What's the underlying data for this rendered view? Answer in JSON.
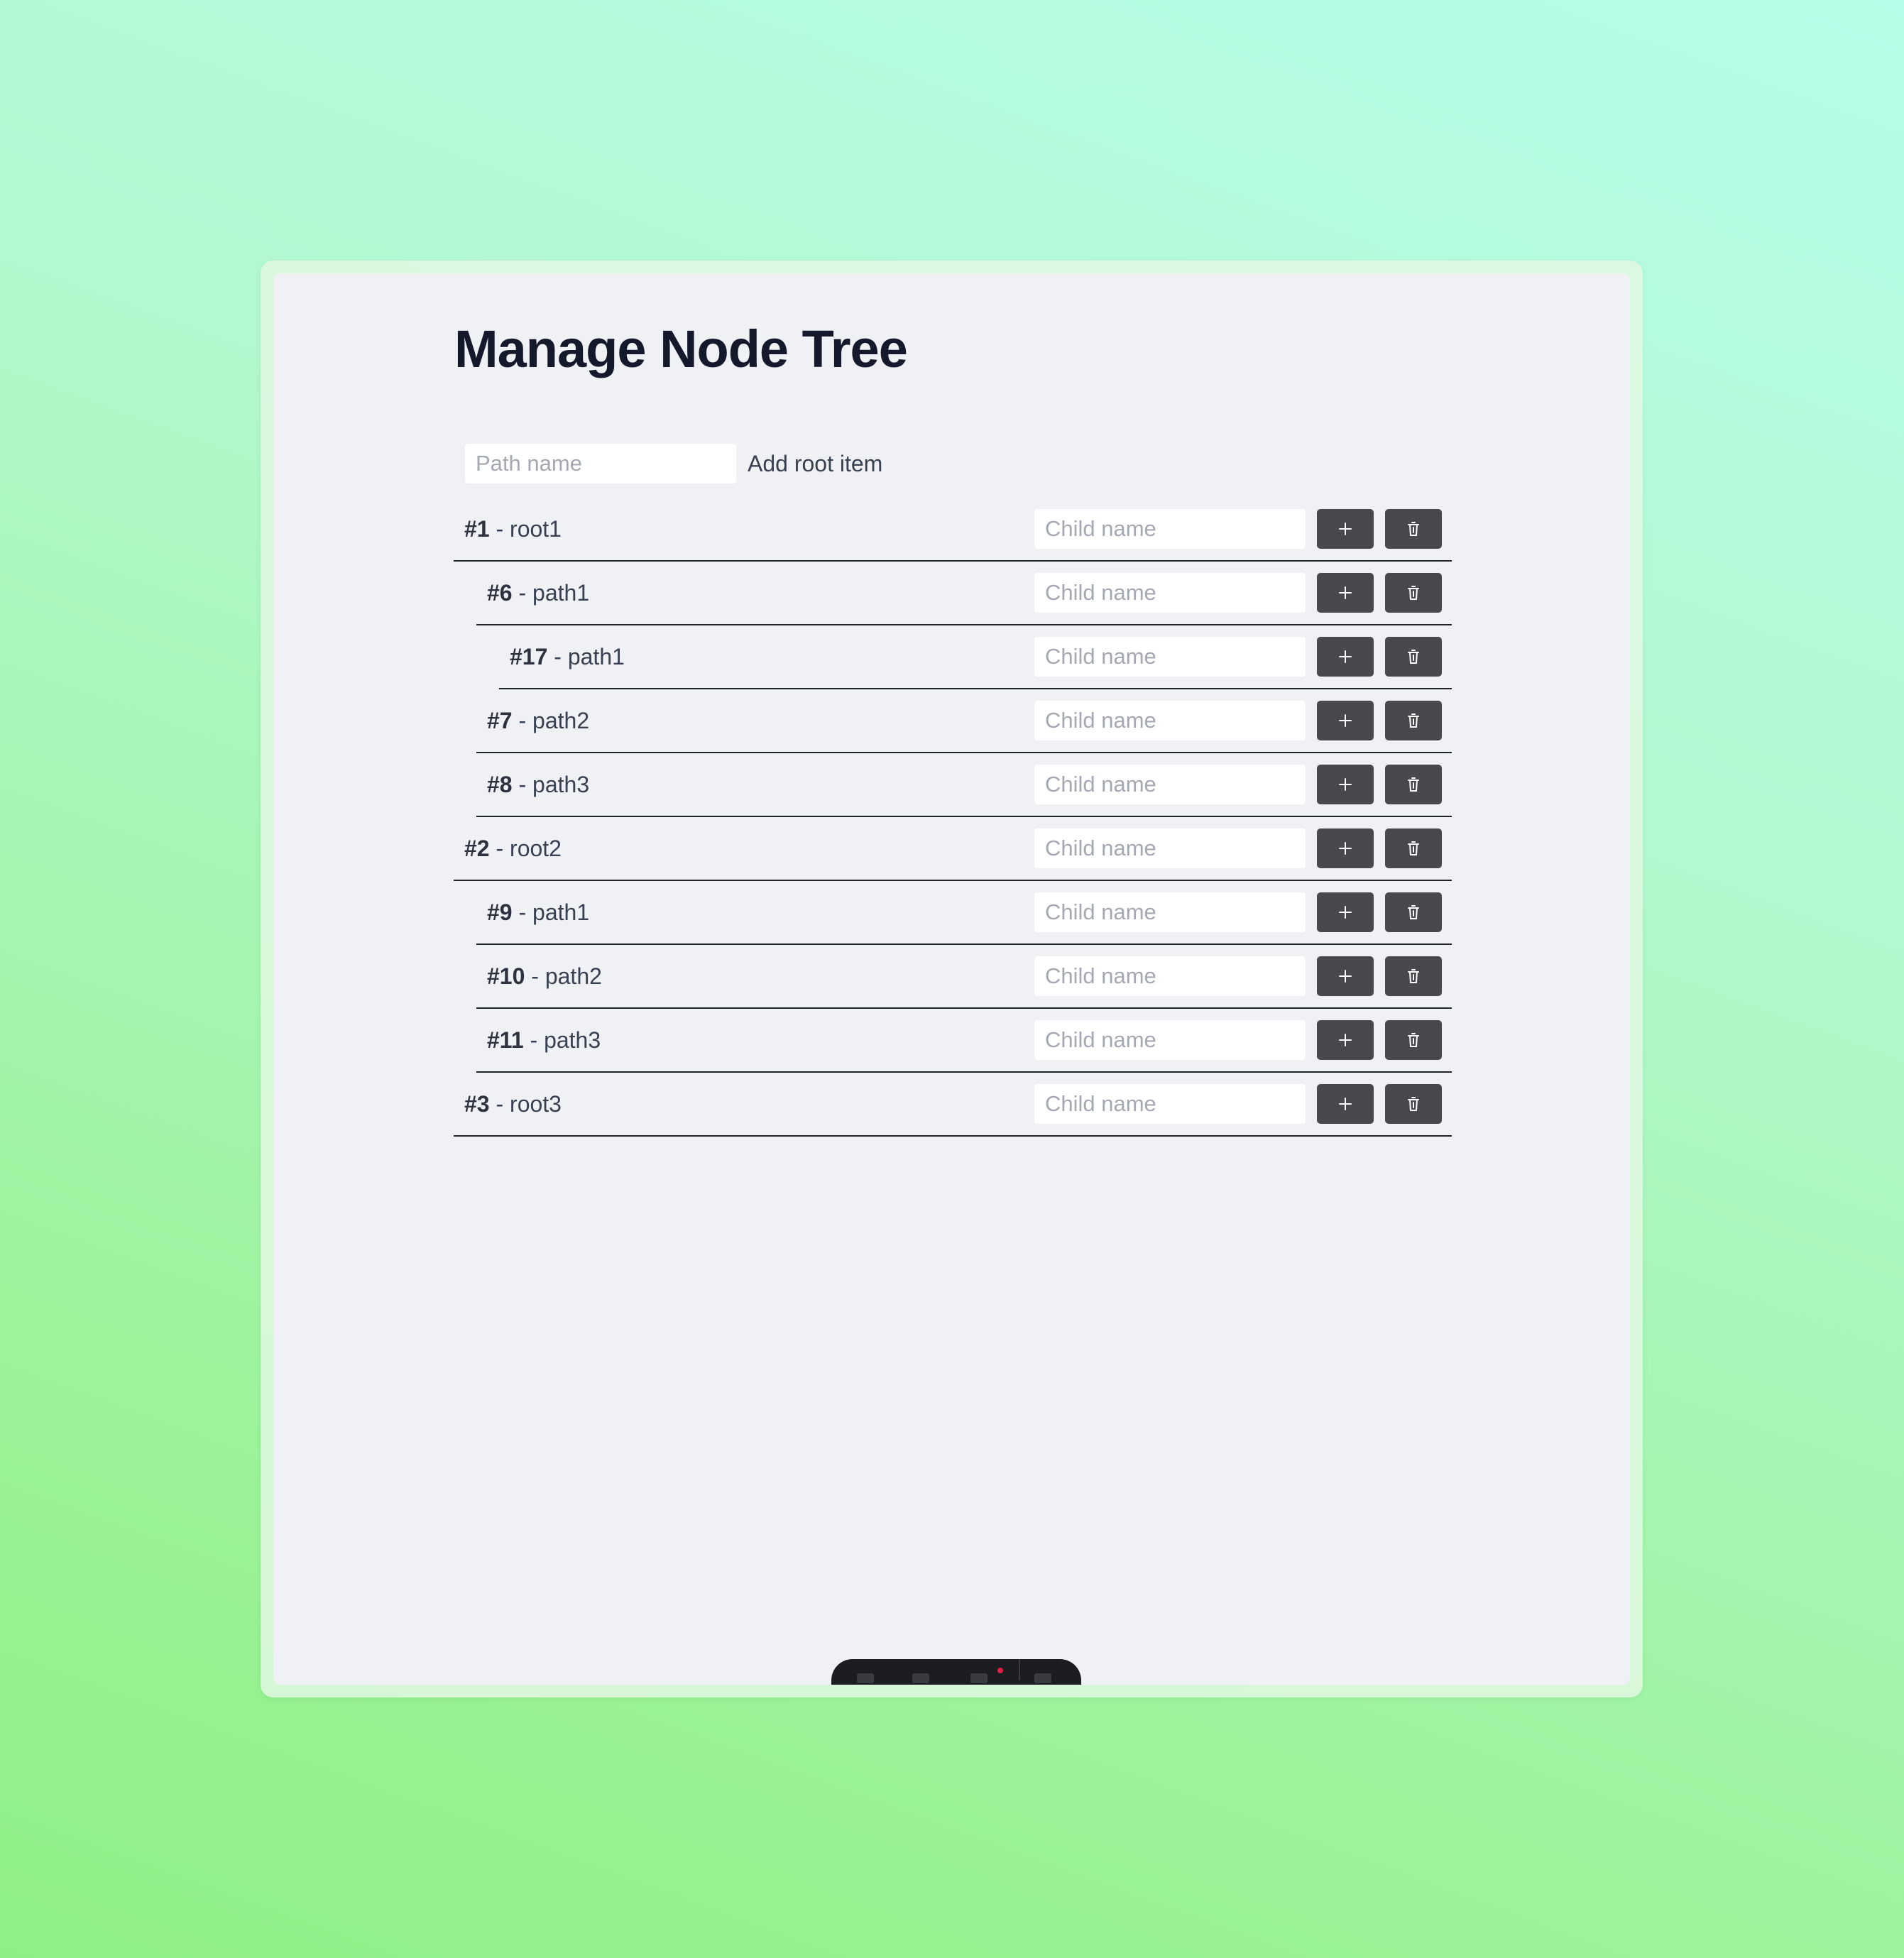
{
  "page": {
    "title": "Manage Node Tree"
  },
  "root_form": {
    "placeholder": "Path name",
    "add_label": "Add root item"
  },
  "child_placeholder": "Child name",
  "nodes": [
    {
      "id": "#1",
      "name": "root1",
      "depth": 0,
      "toggle": "▼"
    },
    {
      "id": "#6",
      "name": "path1",
      "depth": 1,
      "toggle": "▼"
    },
    {
      "id": "#17",
      "name": "path1",
      "depth": 2,
      "toggle": ""
    },
    {
      "id": "#7",
      "name": "path2",
      "depth": 1,
      "toggle": ""
    },
    {
      "id": "#8",
      "name": "path3",
      "depth": 1,
      "toggle": ""
    },
    {
      "id": "#2",
      "name": "root2",
      "depth": 0,
      "toggle": "▼"
    },
    {
      "id": "#9",
      "name": "path1",
      "depth": 1,
      "toggle": ""
    },
    {
      "id": "#10",
      "name": "path2",
      "depth": 1,
      "toggle": "▶"
    },
    {
      "id": "#11",
      "name": "path3",
      "depth": 1,
      "toggle": ""
    },
    {
      "id": "#3",
      "name": "root3",
      "depth": 0,
      "toggle": "▶"
    }
  ],
  "icons": {
    "add": "plus-icon",
    "delete": "trash-icon",
    "expanded": "triangle-down-icon",
    "collapsed": "triangle-right-icon"
  },
  "colors": {
    "button_bg": "#48494d",
    "title": "#141a2b",
    "row_border": "#1f232b"
  }
}
